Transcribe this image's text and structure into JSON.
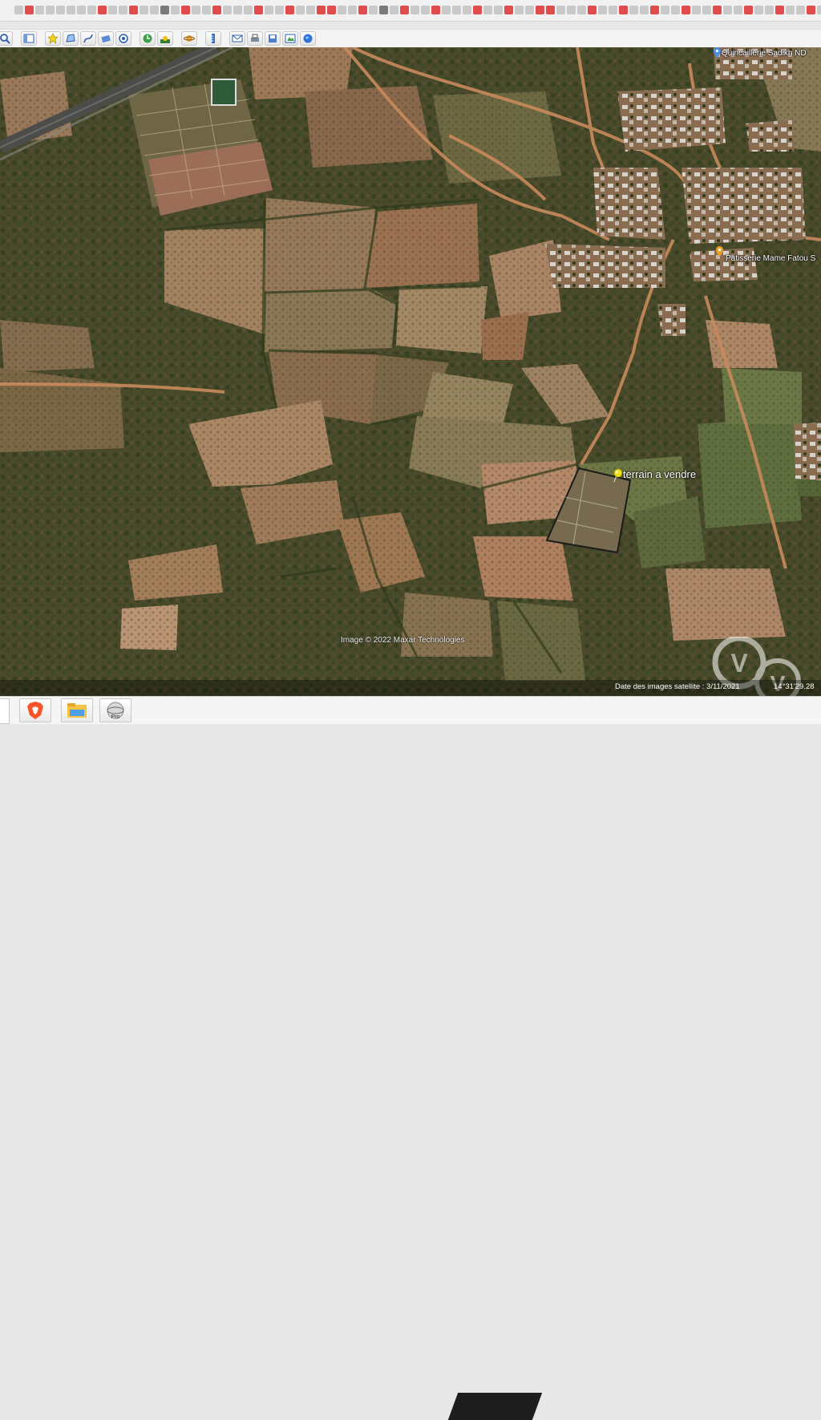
{
  "map": {
    "placemarks": [
      {
        "name": "Quincaillerie Sadikh ND"
      },
      {
        "name": "Patisserie Mame Fatou S"
      },
      {
        "name": "terrain a vendre"
      }
    ],
    "copyright": "Image © 2022 Maxar Technologies",
    "status": {
      "imagery_date": "Date des images satellite : 3/11/2021",
      "time": "14°31'29.28"
    },
    "watermark_letter": "V"
  },
  "toolbar": {
    "icons": [
      "search-icon",
      "sidebar-icon",
      "add-placemark-icon",
      "add-polygon-icon",
      "add-path-icon",
      "add-overlay-icon",
      "record-tour-icon",
      "historical-imagery-icon",
      "sunlight-icon",
      "planets-icon",
      "ruler-icon",
      "email-icon",
      "print-icon",
      "save-image-icon",
      "view-in-maps-icon"
    ]
  },
  "taskbar": {
    "items": [
      "brave-browser-icon",
      "file-explorer-icon",
      "google-earth-pro-icon"
    ]
  },
  "colors": {
    "accent": "#2a5fb0",
    "pin_yellow": "#f2e21b",
    "pin_orange": "#f0a020"
  }
}
